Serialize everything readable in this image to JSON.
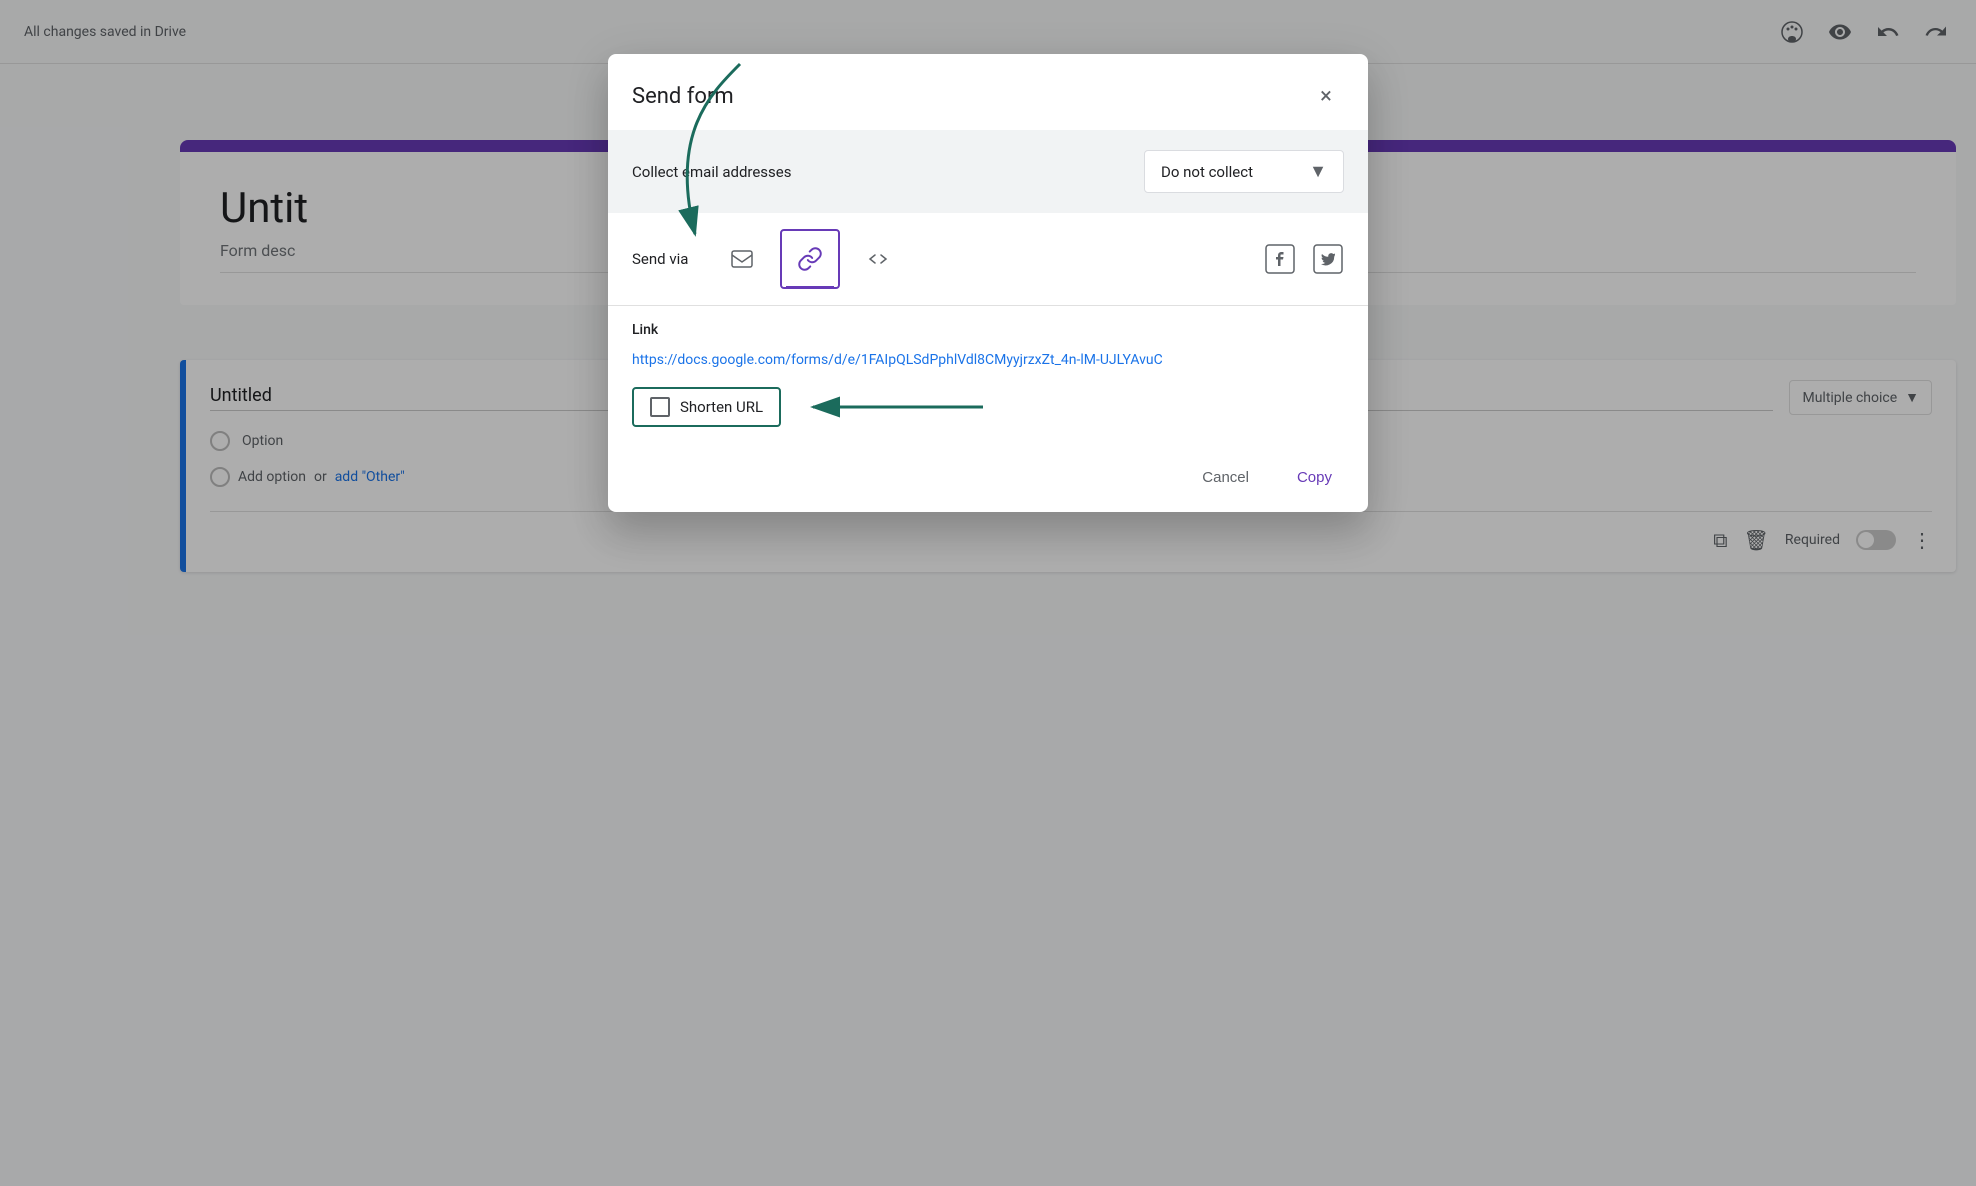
{
  "app": {
    "save_status": "All changes saved in Drive"
  },
  "header": {
    "icons": [
      "palette-icon",
      "eye-icon",
      "undo-icon",
      "redo-icon"
    ]
  },
  "form": {
    "title": "Untit",
    "description": "Form desc"
  },
  "question": {
    "title": "Untitled",
    "type": "Multiple choice",
    "options": [
      "Option"
    ],
    "add_option_text": "Add option",
    "or_text": "or",
    "add_other_text": "add \"Other\"",
    "required_label": "Required"
  },
  "dialog": {
    "title": "Send form",
    "close_label": "×",
    "collect_email_label": "Collect email addresses",
    "collect_dropdown_value": "Do not collect",
    "send_via_label": "Send via",
    "link_label": "Link",
    "link_url": "https://docs.google.com/forms/d/e/1FAIpQLSdPphlVdl8CMyyjrzxZt_4n-lM-UJLYAvuC",
    "shorten_url_label": "Shorten URL",
    "cancel_label": "Cancel",
    "copy_label": "Copy"
  },
  "colors": {
    "purple": "#673ab7",
    "teal": "#1b6b5c",
    "blue_link": "#1a73e8",
    "text_dark": "#202124",
    "text_gray": "#5f6368"
  }
}
